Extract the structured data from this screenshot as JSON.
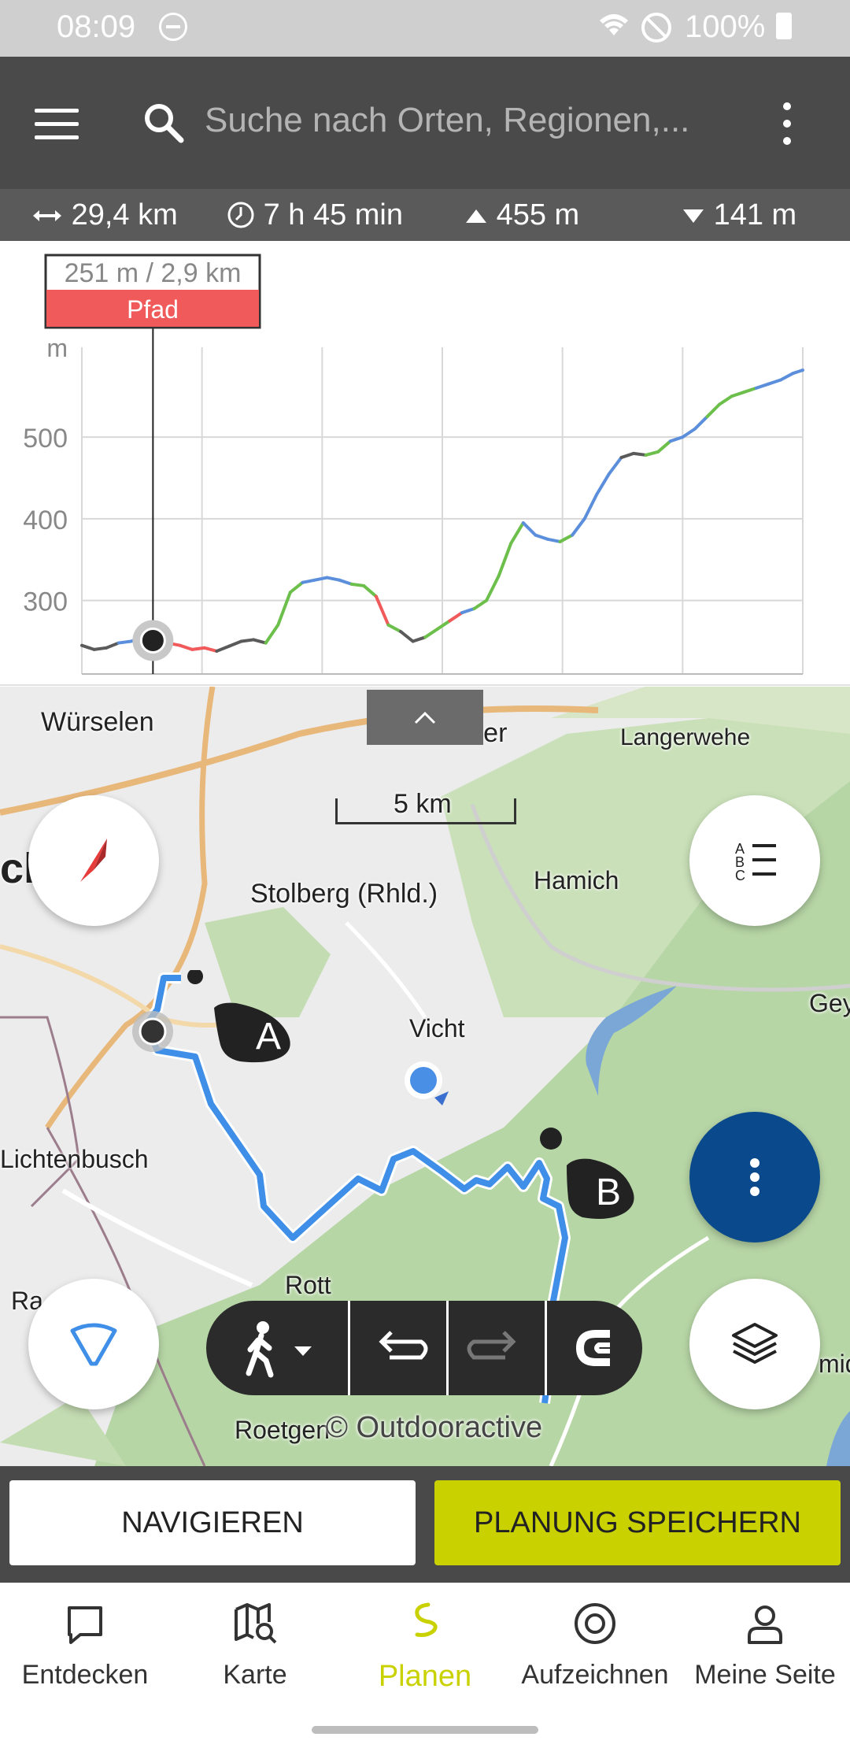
{
  "status_bar": {
    "time": "08:09",
    "battery": "100%"
  },
  "search": {
    "placeholder": "Suche nach Orten, Regionen,..."
  },
  "stats": {
    "distance": "29,4 km",
    "duration": "7 h 45 min",
    "ascent": "455 m",
    "descent": "141 m"
  },
  "chart_data": {
    "type": "line",
    "title": "",
    "xlabel": "",
    "ylabel": "m",
    "y_ticks": [
      "500",
      "400",
      "300"
    ],
    "ylim": [
      210,
      610
    ],
    "xlim": [
      0,
      29.4
    ],
    "grid": true,
    "tooltip": {
      "value": "251 m / 2,9 km",
      "surface": "Pfad"
    },
    "surface_colors": {
      "Pfad": "#f05a5a",
      "Weg": "#5b8fdc",
      "Strasse": "#5a5a5a",
      "Naturweg": "#6cbf4a"
    },
    "series": [
      {
        "x": [
          0,
          0.5,
          1.0,
          1.5,
          2.0,
          2.5,
          2.9,
          3.2,
          3.5,
          4.0,
          4.5,
          5.0,
          5.5,
          6.0,
          6.5,
          7.0,
          7.5,
          8.0,
          8.5,
          9.0,
          9.5,
          10.0,
          10.5,
          11.0,
          11.5,
          12.0,
          12.5,
          13.0,
          13.5,
          14.0,
          14.5,
          15.0,
          15.5,
          16.0,
          16.5,
          17.0,
          17.5,
          18.0,
          18.5,
          19.0,
          19.5,
          20.0,
          20.5,
          21.0,
          21.5,
          22.0,
          22.5,
          23.0,
          23.5,
          24.0,
          24.5,
          25.0,
          25.5,
          26.0,
          26.5,
          27.0,
          27.5,
          28.0,
          28.5,
          29.0,
          29.4
        ],
        "y": [
          245,
          240,
          242,
          248,
          250,
          255,
          251,
          238,
          248,
          245,
          240,
          242,
          238,
          244,
          250,
          252,
          248,
          270,
          310,
          322,
          325,
          328,
          325,
          320,
          318,
          305,
          270,
          262,
          250,
          255,
          265,
          275,
          285,
          290,
          300,
          330,
          370,
          395,
          380,
          375,
          372,
          380,
          400,
          430,
          455,
          475,
          480,
          478,
          482,
          495,
          500,
          510,
          525,
          540,
          550,
          555,
          560,
          565,
          570,
          578,
          582
        ]
      }
    ]
  },
  "map": {
    "scale": "5 km",
    "places": [
      "Würselen",
      "Eschweiler",
      "Langerwehe",
      "chen",
      "Stolberg (Rhld.)",
      "Hamich",
      "Vicht",
      "Gey",
      "Lichtenbusch",
      "Rott",
      "Ra",
      "midt",
      "Roetgen"
    ],
    "markers": {
      "start": "A",
      "end": "B"
    },
    "copyright": "© Outdooractive",
    "route_color": "#3f8fe8",
    "forest_color": "#b7d6a6"
  },
  "actions": {
    "navigate": "NAVIGIEREN",
    "save": "PLANUNG SPEICHERN"
  },
  "tabs": [
    {
      "label": "Entdecken",
      "icon": "speech-bubble-icon"
    },
    {
      "label": "Karte",
      "icon": "map-search-icon"
    },
    {
      "label": "Planen",
      "icon": "route-icon",
      "active": true
    },
    {
      "label": "Aufzeichnen",
      "icon": "record-icon"
    },
    {
      "label": "Meine Seite",
      "icon": "user-icon"
    }
  ],
  "colors": {
    "accent": "#c9d200",
    "header": "#4a4a4a",
    "fab_blue": "#0a4a8c"
  }
}
